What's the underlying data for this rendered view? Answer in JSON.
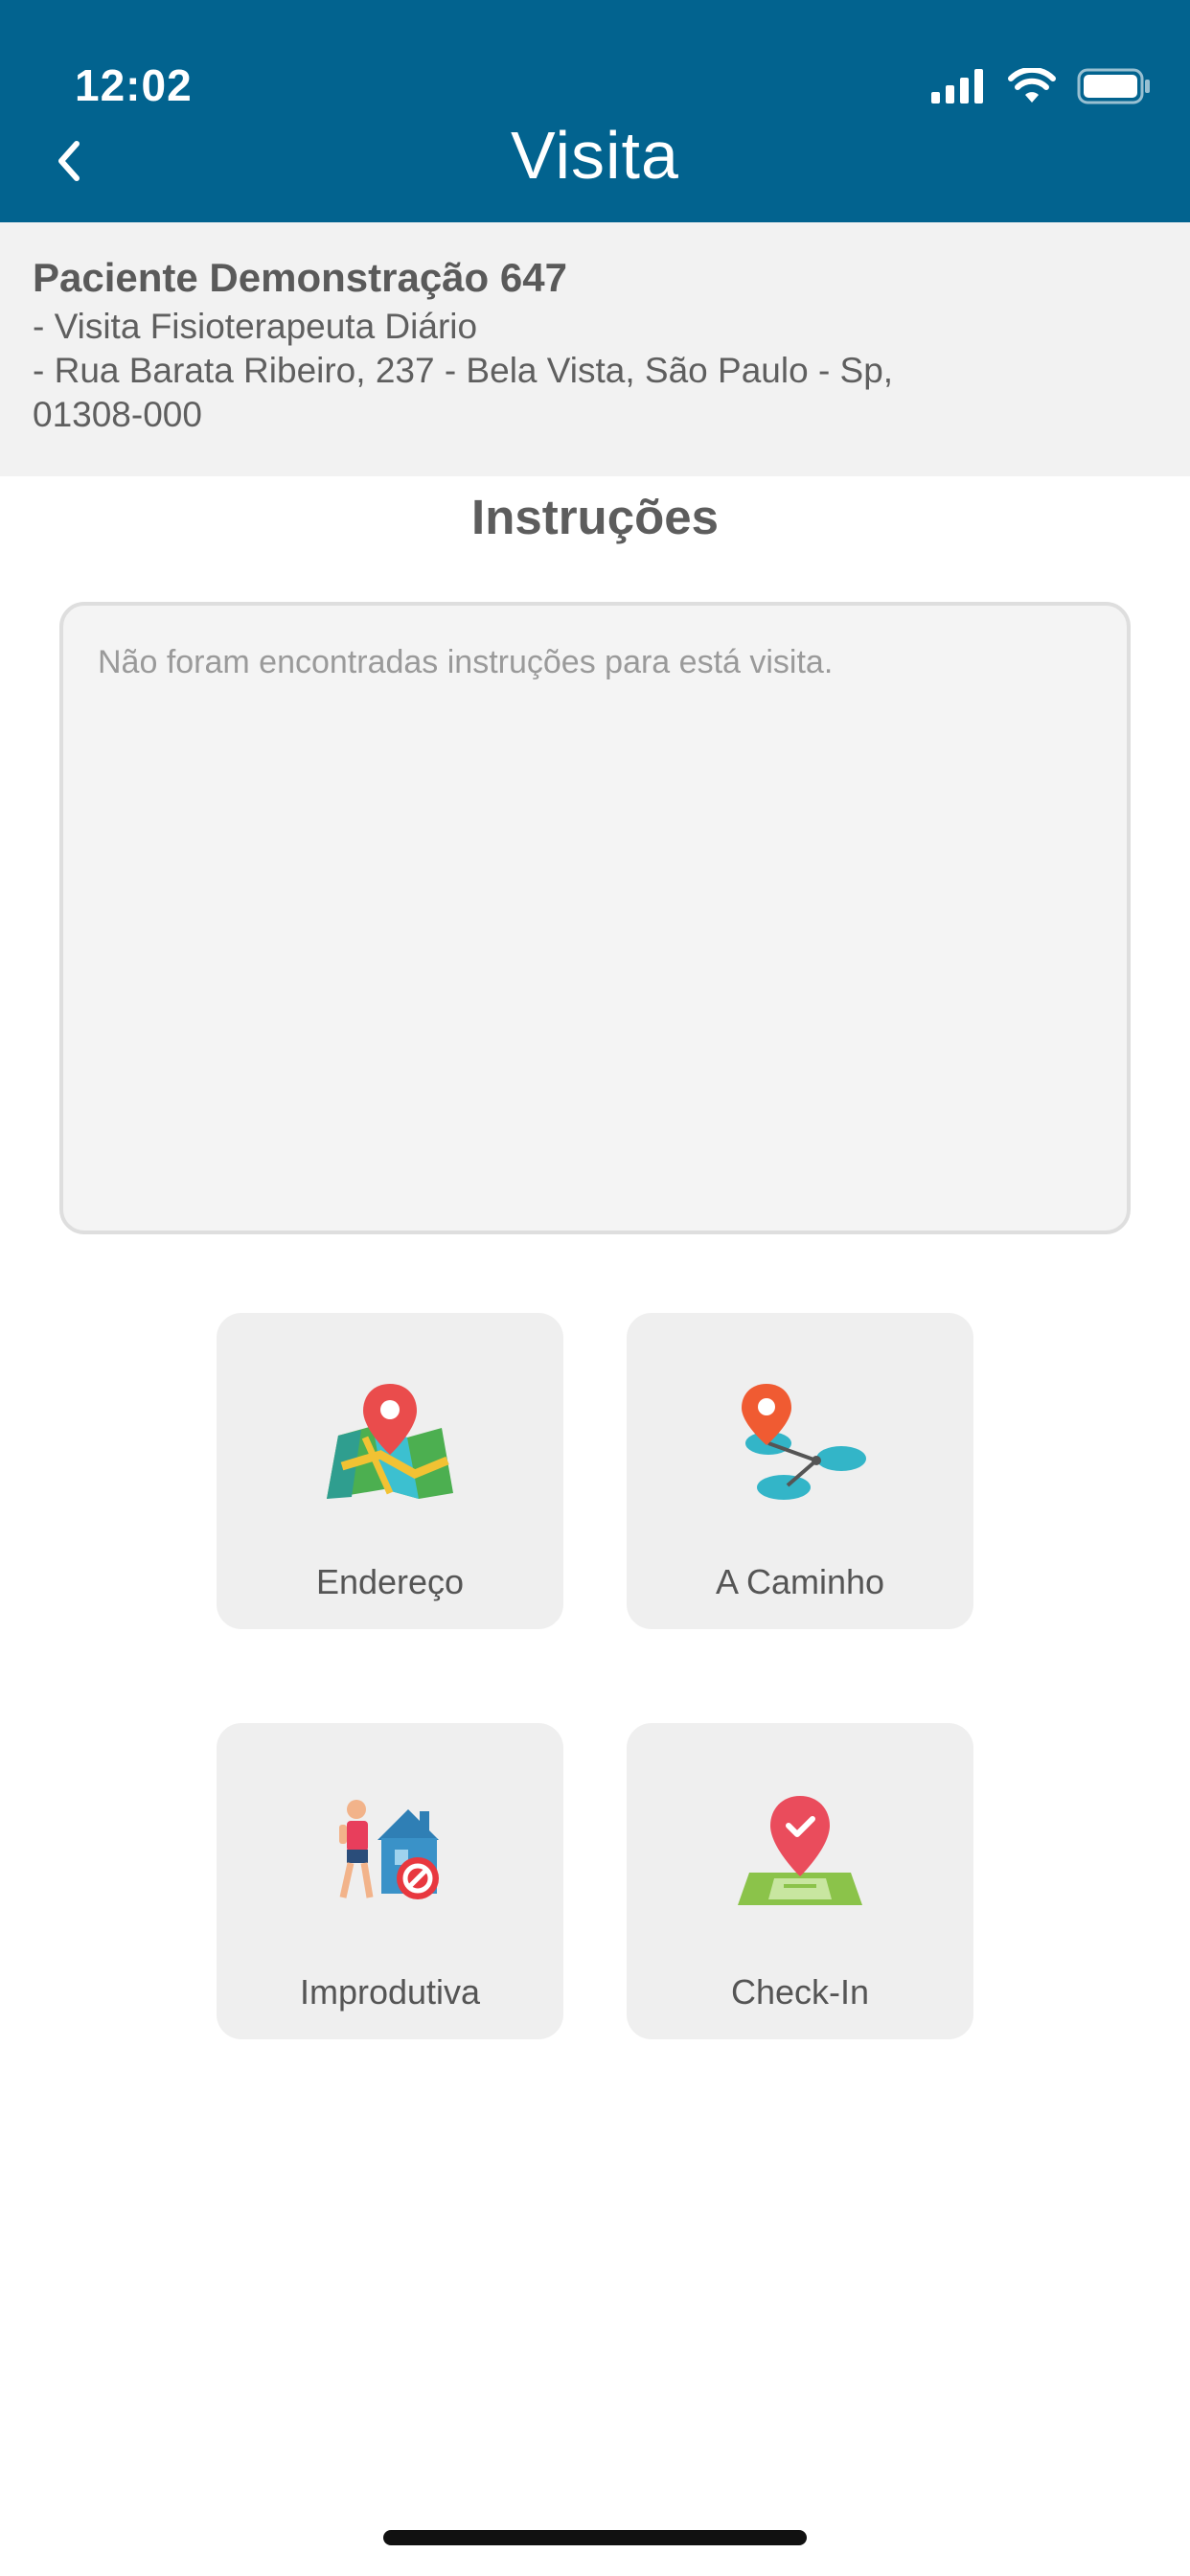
{
  "status_bar": {
    "time": "12:02"
  },
  "header": {
    "title": "Visita",
    "back_icon": "chevron-left-icon",
    "background": "#02638f"
  },
  "patient": {
    "name": "Paciente Demonstração 647",
    "visit_type": "- Visita Fisioterapeuta Diário",
    "address_line1": "- Rua Barata Ribeiro, 237  - Bela Vista, São Paulo - Sp,",
    "address_line2": "01308-000"
  },
  "instructions": {
    "title": "Instruções",
    "text": "Não foram encontradas instruções para está visita."
  },
  "actions": [
    {
      "label": "Endereço",
      "icon": "map-pin-icon"
    },
    {
      "label": "A Caminho",
      "icon": "route-icon"
    },
    {
      "label": "Improdutiva",
      "icon": "unproductive-visit-icon"
    },
    {
      "label": "Check-In",
      "icon": "check-in-pin-icon"
    }
  ]
}
